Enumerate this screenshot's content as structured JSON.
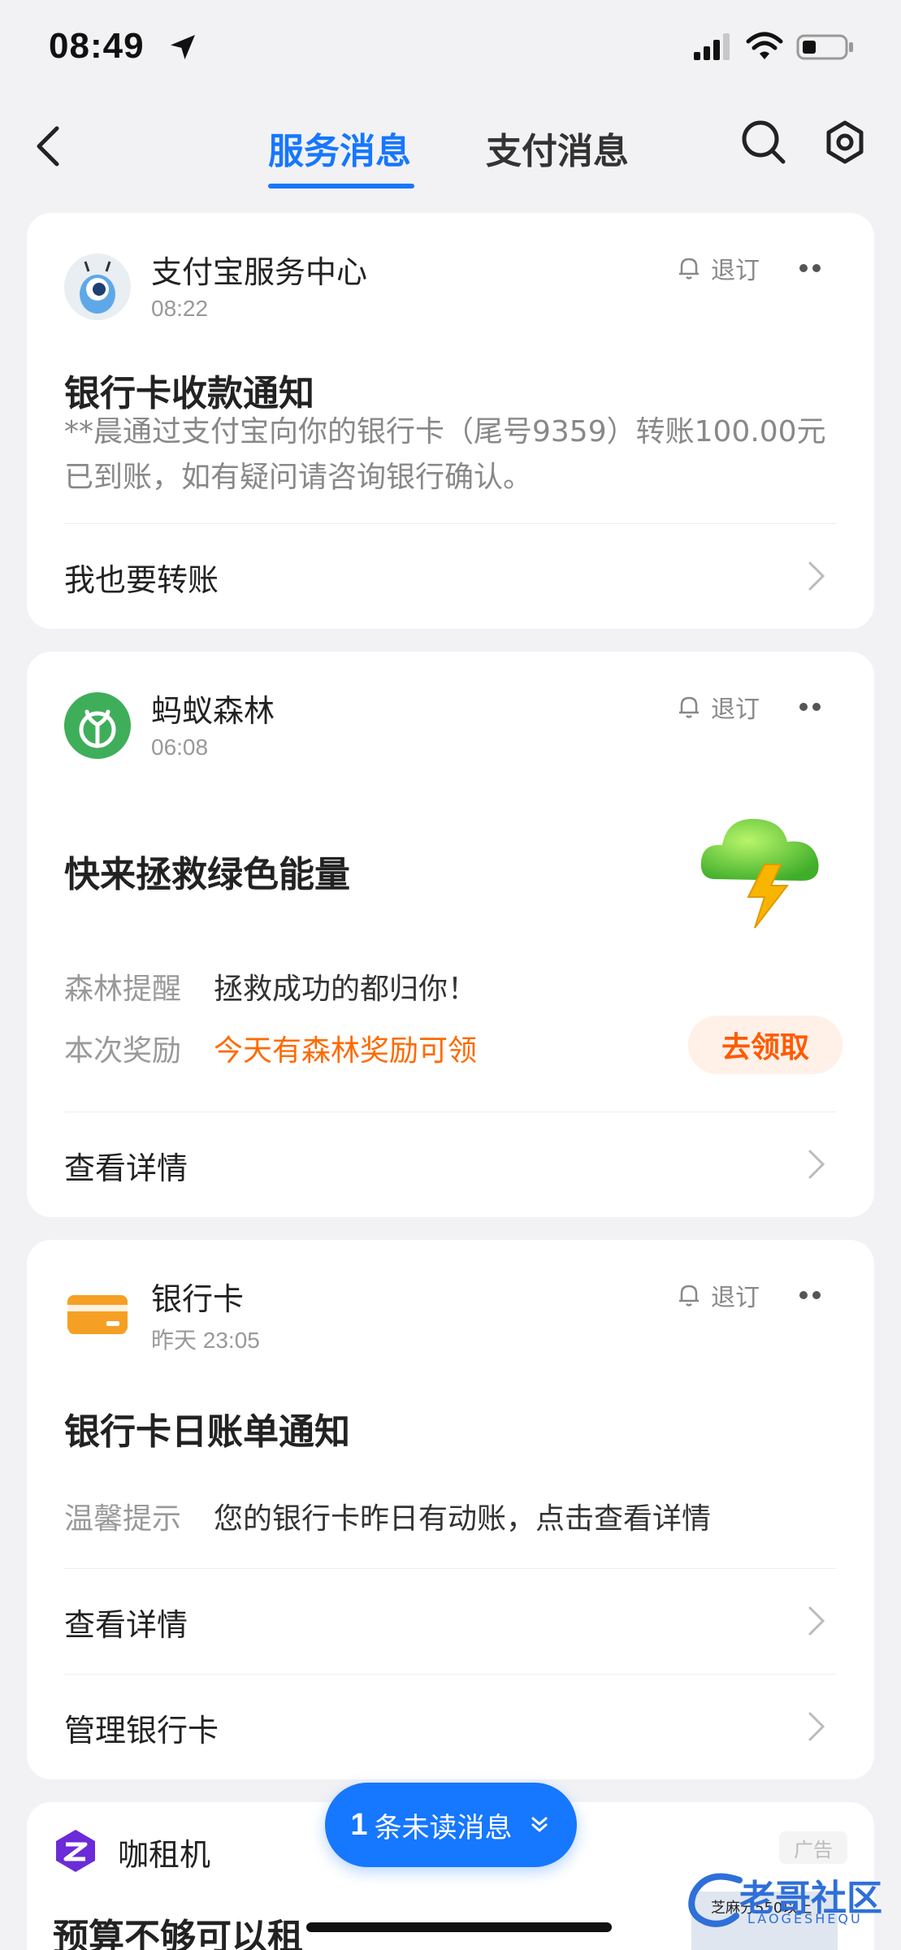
{
  "status_bar": {
    "time": "08:49"
  },
  "nav": {
    "tab_service": "服务消息",
    "tab_pay": "支付消息"
  },
  "cards": [
    {
      "sender": "支付宝服务中心",
      "time": "08:22",
      "unsubscribe": "退订",
      "title": "银行卡收款通知",
      "body": "**晨通过支付宝向你的银行卡（尾号9359）转账100.00元已到账，如有疑问请咨询银行确认。",
      "action": "我也要转账"
    },
    {
      "sender": "蚂蚁森林",
      "time": "06:08",
      "unsubscribe": "退订",
      "title": "快来拯救绿色能量",
      "kv": [
        {
          "key": "森林提醒",
          "value": "拯救成功的都归你！"
        },
        {
          "key": "本次奖励",
          "value": "今天有森林奖励可领"
        }
      ],
      "claim_button": "去领取",
      "action": "查看详情"
    },
    {
      "sender": "银行卡",
      "time": "昨天 23:05",
      "unsubscribe": "退订",
      "title": "银行卡日账单通知",
      "kv": [
        {
          "key": "温馨提示",
          "value": "您的银行卡昨日有动账，点击查看详情"
        }
      ],
      "actions": [
        "查看详情",
        "管理银行卡"
      ]
    },
    {
      "sender": "咖租机",
      "ad_tag": "广告",
      "title": "预算不够可以租",
      "ad_image_text": "芝麻分550以上"
    }
  ],
  "unread_pill": {
    "count": "1",
    "label": "条未读消息"
  },
  "watermark": {
    "text": "老哥社区",
    "sub": "LAOGESHEQU"
  },
  "colors": {
    "accent": "#1677ff",
    "orange": "#ff6a00",
    "forest_green": "#3fae5a",
    "bank_orange": "#f5a024"
  }
}
